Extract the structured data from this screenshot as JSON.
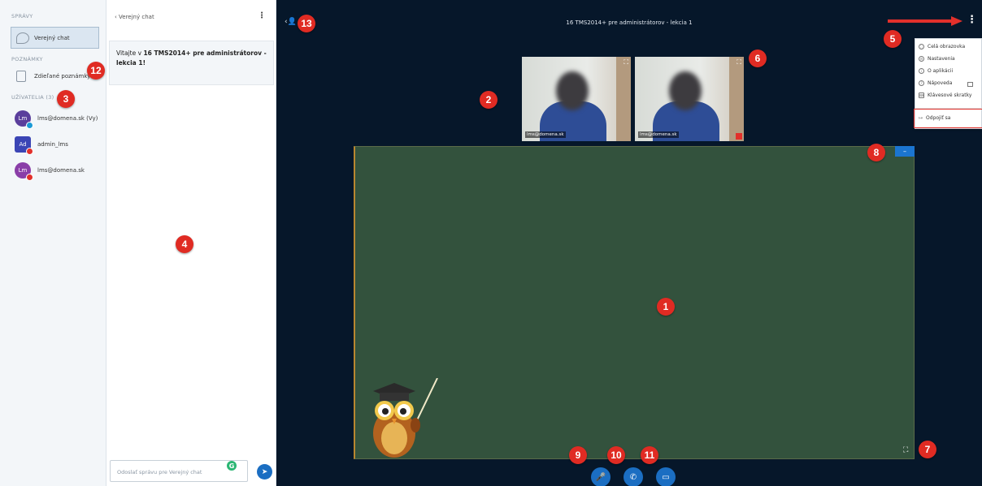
{
  "sidebar": {
    "messages_heading": "SPRÁVY",
    "public_chat_label": "Verejný chat",
    "notes_heading": "POZNÁMKY",
    "shared_notes_label": "Zdieľané poznámky",
    "users_heading": "UŽÍVATELIA (3)",
    "users": [
      {
        "initials": "Lm",
        "name": "lms@domena.sk (Vy)",
        "color": "#5a3e9c",
        "badge_color": "#1b9ad6"
      },
      {
        "initials": "Ad",
        "name": "admin_lms",
        "color": "#3b45b5",
        "badge_color": "#e2302b"
      },
      {
        "initials": "Lm",
        "name": "lms@domena.sk",
        "color": "#8a3ea8",
        "badge_color": "#e2302b"
      }
    ]
  },
  "chat": {
    "back_label": "Verejný chat",
    "welcome_prefix": "Vitajte v ",
    "welcome_bold": "16 TMS2014+ pre administrátorov - lekcia 1",
    "welcome_suffix": "!",
    "input_placeholder": "Odoslať správu pre Verejný chat",
    "grammarly_letter": "G"
  },
  "main": {
    "title": "16 TMS2014+ pre administrátorov - lekcia 1",
    "videos": [
      {
        "label": "lms@domena.sk"
      },
      {
        "label": "lms@domena.sk"
      }
    ],
    "board_button": "–"
  },
  "options_menu": {
    "items": [
      "Celá obrazovka",
      "Nastavenia",
      "O aplikácii",
      "Nápoveda",
      "Klávesové skratky"
    ],
    "leave": "Odpojiť sa"
  },
  "annotations": [
    "1",
    "2",
    "3",
    "4",
    "5",
    "6",
    "7",
    "8",
    "9",
    "10",
    "11",
    "12",
    "13"
  ],
  "colors": {
    "accent": "#1b6ec2",
    "main_bg": "#06172a",
    "board": "#33523d",
    "annotation_red": "#e02b23"
  }
}
